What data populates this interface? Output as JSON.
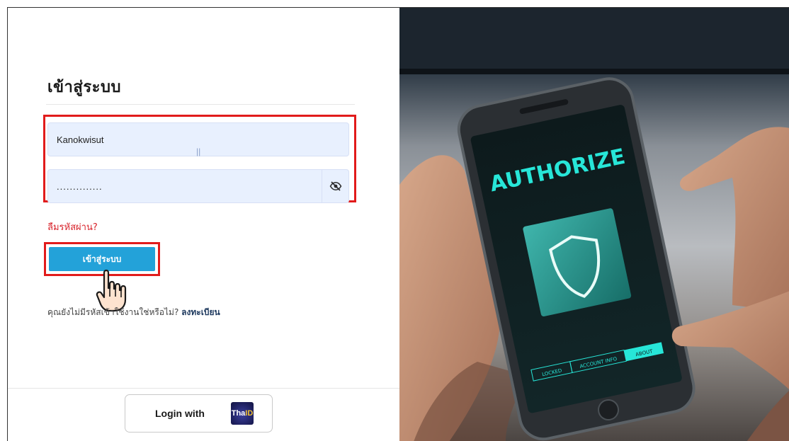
{
  "login": {
    "title": "เข้าสู่ระบบ",
    "username_value": "Kanokwisut",
    "password_value": "..............",
    "text_cursor": "||",
    "forgot_password": "ลืมรหัสผ่าน?",
    "submit_label": "เข้าสู่ระบบ",
    "register_prompt": "คุณยังไม่มีรหัสเข้าใช้งานใช่หรือไม่?",
    "register_link": "ลงทะเบียน"
  },
  "thaid": {
    "label": "Login with",
    "logo_text": "Tha",
    "logo_text_id": "ID"
  },
  "hero": {
    "screen_title": "AUTHORIZE",
    "tabs": [
      "LOCKED",
      "ACCOUNT INFO",
      "ABOUT"
    ],
    "active_tab_index": 2
  },
  "colors": {
    "accent_button": "#23a2d9",
    "highlight": "#e11b1b",
    "forgot_link": "#d8222a",
    "input_bg": "#e8f0fe",
    "screen_text": "#27e6d8"
  },
  "icons": {
    "password_toggle": "eye-slash-icon",
    "pointer": "hand-pointer-icon"
  }
}
